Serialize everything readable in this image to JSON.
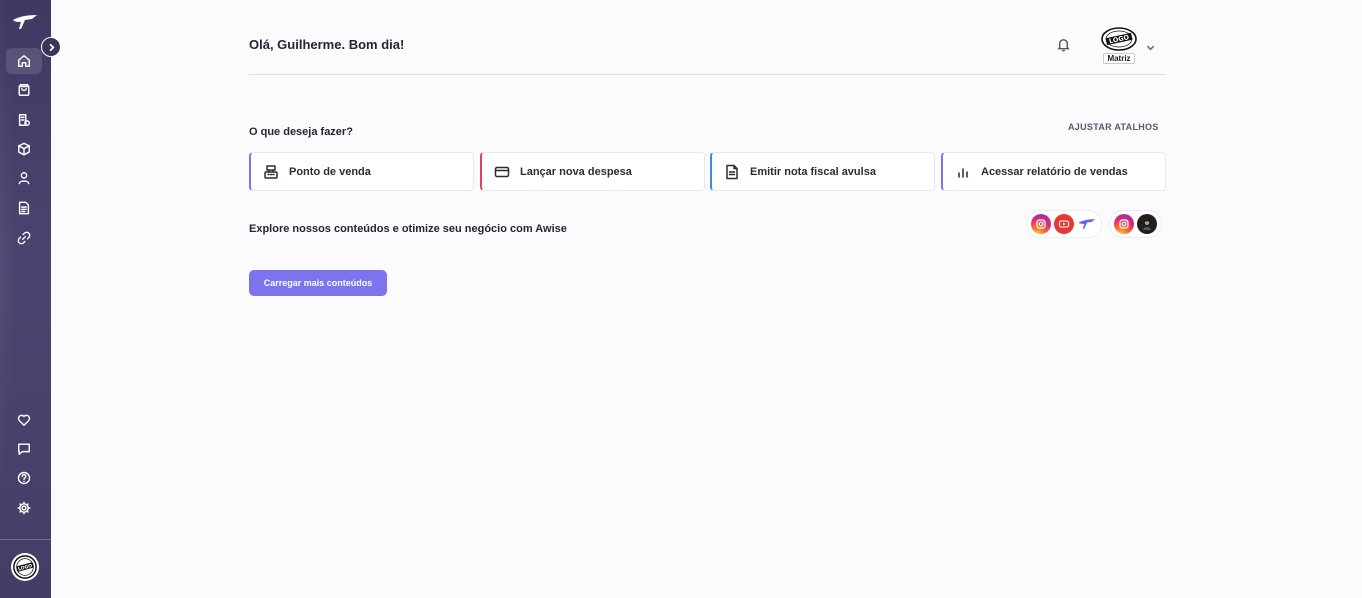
{
  "header": {
    "greeting": "Olá, Guilherme. Bom dia!",
    "company_badge": "Matriz",
    "logo_text": "LOGO"
  },
  "shortcuts": {
    "title": "O que deseja fazer?",
    "adjust_label": "AJUSTAR ATALHOS",
    "items": [
      {
        "label": "Ponto de venda",
        "icon": "cash-register-icon",
        "accent": "#7b74ec"
      },
      {
        "label": "Lançar nova despesa",
        "icon": "credit-card-icon",
        "accent": "#e0435d"
      },
      {
        "label": "Emitir nota fiscal avulsa",
        "icon": "document-icon",
        "accent": "#3b8de0"
      },
      {
        "label": "Acessar relatório de vendas",
        "icon": "bar-chart-icon",
        "accent": "#7b74ec"
      }
    ]
  },
  "content": {
    "explore_text": "Explore nossos conteúdos e otimize seu negócio com Awise",
    "load_more_label": "Carregar mais conteúdos",
    "social_groups": [
      [
        "instagram-icon",
        "youtube-icon",
        "awise-icon"
      ],
      [
        "instagram-icon",
        "person-avatar-icon"
      ]
    ]
  },
  "sidebar": {
    "top_items": [
      "home-icon",
      "shopping-bag-icon",
      "finance-icon",
      "package-icon",
      "user-icon",
      "document-icon",
      "link-icon"
    ],
    "bottom_items": [
      "heart-icon",
      "chat-icon",
      "help-icon",
      "settings-icon"
    ],
    "active": "home-icon"
  },
  "colors": {
    "sidebar": "#433e66",
    "primary": "#7b74ec",
    "background": "#fbfbfd"
  }
}
